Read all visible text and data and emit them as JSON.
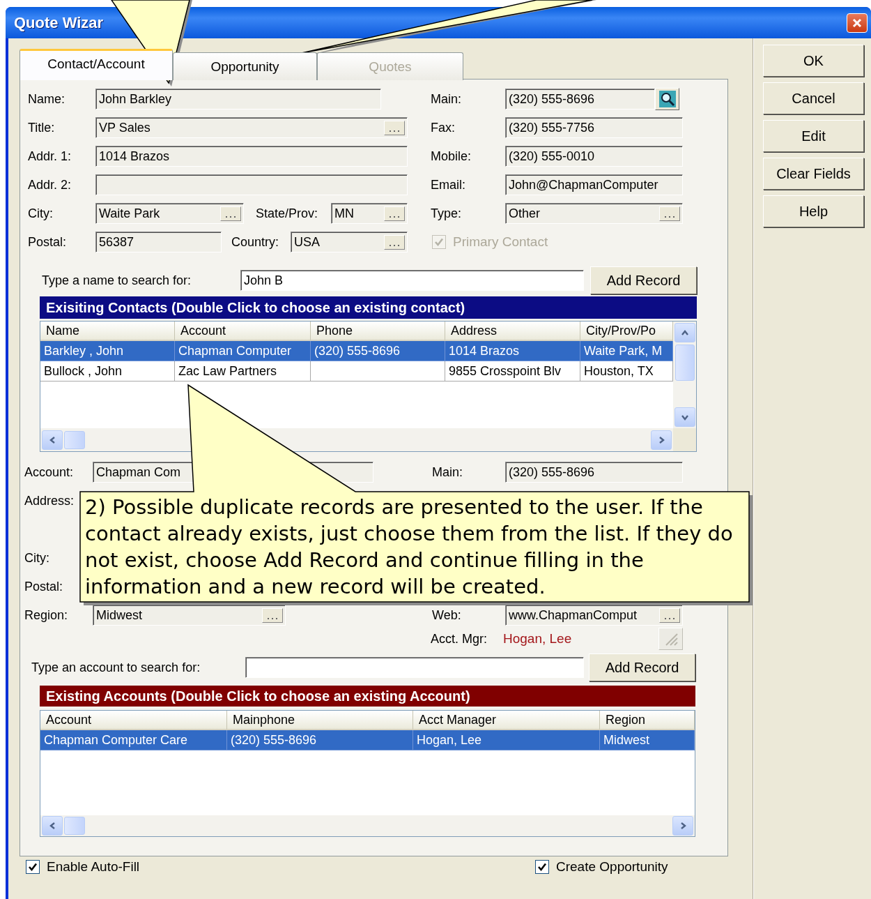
{
  "window": {
    "title": "Quote Wizar"
  },
  "tabs": [
    {
      "label": "Contact/Account",
      "selected": true,
      "disabled": false
    },
    {
      "label": "Opportunity",
      "selected": false,
      "disabled": false
    },
    {
      "label": "Quotes",
      "selected": false,
      "disabled": true
    }
  ],
  "contact": {
    "left_rows": [
      [
        {
          "label": "Name:",
          "value": "John Barkley",
          "browse": false
        }
      ],
      [
        {
          "label": "Title:",
          "value": "VP Sales",
          "browse": true
        }
      ],
      [
        {
          "label": "Addr. 1:",
          "value": "1014 Brazos",
          "browse": false
        }
      ],
      [
        {
          "label": "Addr. 2:",
          "browse": false
        }
      ],
      [
        {
          "label": "City:",
          "value": "Waite Park",
          "browse": true
        },
        {
          "label": "State/Prov:",
          "value": "MN",
          "browse": true
        }
      ],
      [
        {
          "label": "Postal:",
          "value": "56387",
          "browse": false
        },
        {
          "label": "Country:",
          "value": "USA",
          "browse": true
        }
      ]
    ],
    "right_rows": [
      {
        "label": "Main:",
        "value": "(320) 555-8696",
        "browse": false,
        "lookup": true
      },
      {
        "label": "Fax:",
        "value": "(320) 555-7756",
        "browse": false,
        "lookup": false
      },
      {
        "label": "Mobile:",
        "value": "(320) 555-0010",
        "browse": false,
        "lookup": false
      },
      {
        "label": "Email:",
        "value": "John@ChapmanComputer",
        "browse": false,
        "lookup": false
      },
      {
        "label": "Type:",
        "value": "Other",
        "browse": true,
        "lookup": false
      }
    ],
    "primary_contact": {
      "label": "Primary Contact",
      "checked": true,
      "disabled": true
    },
    "search": {
      "label": "Type a name to search for:",
      "value": "John B",
      "button": "Add Record"
    },
    "list": {
      "title": "Exisiting Contacts (Double Click to choose an existing contact)",
      "columns": [
        "Name",
        "Account",
        "Phone",
        "Address",
        "City/Prov/Po"
      ],
      "rows": [
        {
          "cells": [
            "Barkley , John",
            "Chapman Computer",
            "(320) 555-8696",
            "1014 Brazos",
            "Waite Park, M"
          ],
          "selected": true
        },
        {
          "cells": [
            "Bullock , John",
            "Zac Law Partners",
            null,
            "9855 Crosspoint Blv",
            "Houston, TX"
          ],
          "selected": false
        }
      ]
    }
  },
  "account": {
    "left_rows": [
      {
        "kind": "field",
        "label": "Account:",
        "value": "Chapman Com",
        "browse": false
      },
      {
        "kind": "label",
        "label": "Address:"
      },
      {
        "kind": "label",
        "label": "City:"
      },
      {
        "kind": "label",
        "label": "Postal:"
      },
      {
        "kind": "field",
        "label": "Region:",
        "value": "Midwest",
        "browse": true
      }
    ],
    "right_rows": [
      {
        "kind": "field",
        "label": "Main:",
        "value": "(320) 555-8696",
        "browse": false
      },
      {
        "kind": "field",
        "label": "Web:",
        "value": "www.ChapmanComput",
        "browse": true
      }
    ],
    "acct_mgr": {
      "label": "Acct. Mgr:",
      "value": "Hogan, Lee",
      "button_disabled": true
    },
    "search": {
      "label": "Type an account to search for:",
      "button": "Add Record"
    },
    "list": {
      "title": "Existing Accounts (Double Click to choose an existing Account)",
      "columns": [
        "Account",
        "Mainphone",
        "Acct Manager",
        "Region"
      ],
      "rows": [
        {
          "cells": [
            "Chapman Computer Care",
            "(320) 555-8696",
            "Hogan, Lee",
            "Midwest"
          ],
          "selected": true
        }
      ]
    }
  },
  "options": [
    {
      "label": "Enable Auto-Fill",
      "checked": true
    },
    {
      "label": "Create Opportunity",
      "checked": true
    }
  ],
  "buttons": [
    "OK",
    "Cancel",
    "Edit",
    "Clear Fields",
    "Help"
  ],
  "callout": {
    "text": "2) Possible duplicate records are presented to the user. If the contact already exists, just choose them from the list. If they do not exist, choose Add Record and continue filling in the information and a new record will be created."
  }
}
